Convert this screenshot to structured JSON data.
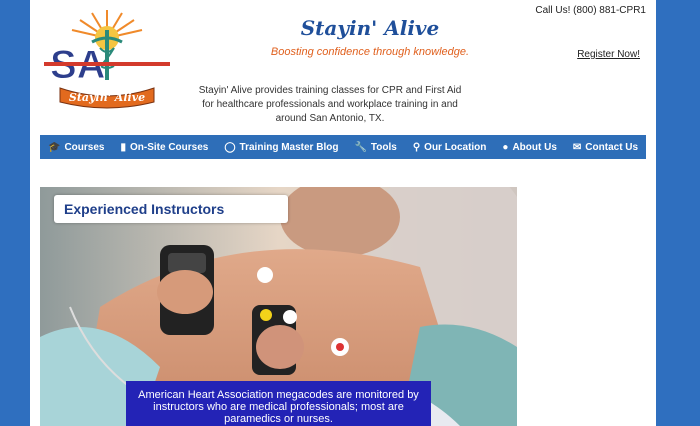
{
  "header": {
    "call_text": "Call Us! (800) 881-CPR1",
    "register_label": "Register Now!",
    "brand_title": "Stayin' Alive",
    "tagline": "Boosting confidence through knowledge.",
    "description": "Stayin' Alive provides training classes for CPR and First Aid for healthcare professionals and workplace training in and around San Antonio, TX.",
    "logo_ribbon": "Stayin' Alive",
    "logo_letters": "SA"
  },
  "nav": {
    "items": [
      {
        "label": "Courses",
        "icon": "graduation-cap-icon"
      },
      {
        "label": "On-Site Courses",
        "icon": "book-icon"
      },
      {
        "label": "Training Master Blog",
        "icon": "chat-icon"
      },
      {
        "label": "Tools",
        "icon": "wrench-icon"
      },
      {
        "label": "Our Location",
        "icon": "map-marker-icon"
      },
      {
        "label": "About Us",
        "icon": "users-icon"
      },
      {
        "label": "Contact Us",
        "icon": "envelope-icon"
      }
    ]
  },
  "hero": {
    "caption": "Experienced Instructors",
    "overlay_text": "American Heart Association megacodes are monitored by instructors who are medical professionals; most are paramedics or nurses."
  },
  "colors": {
    "background": "#2f6fbf",
    "nav_bg": "#2e6eb8",
    "brand_blue": "#1f4f9a",
    "tagline_orange": "#e0601e",
    "overlay_blue": "#2323b6"
  }
}
